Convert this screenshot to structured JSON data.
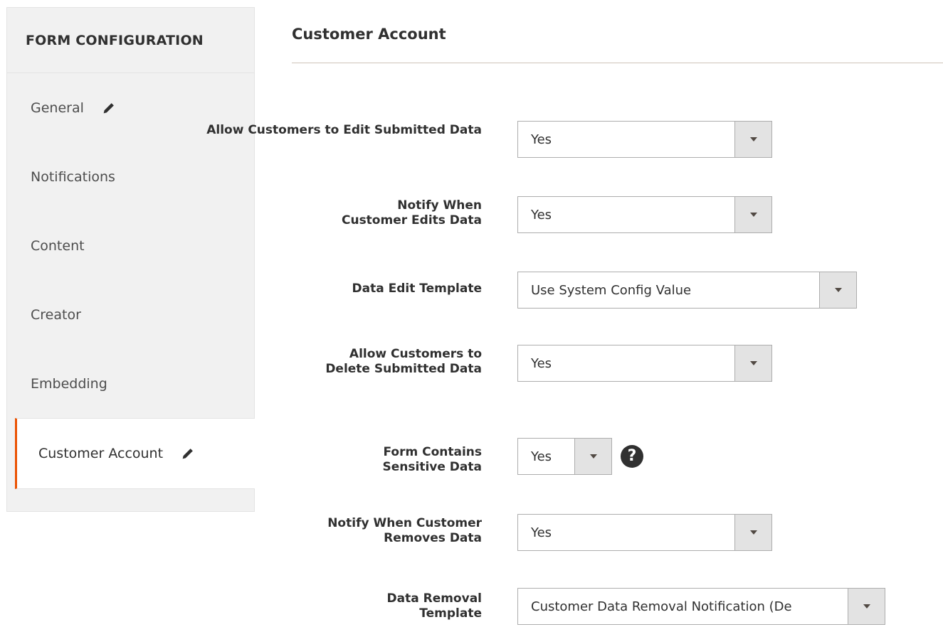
{
  "sidebar": {
    "header": "FORM CONFIGURATION",
    "items": [
      {
        "label": "General"
      },
      {
        "label": "Notifications"
      },
      {
        "label": "Content"
      },
      {
        "label": "Creator"
      },
      {
        "label": "Embedding"
      },
      {
        "label": "Customer Account"
      }
    ]
  },
  "main": {
    "title": "Customer Account",
    "fields": [
      {
        "label": "Allow Customers to Edit Submitted Data",
        "value": "Yes"
      },
      {
        "label": "Notify When Customer Edits Data",
        "value": "Yes"
      },
      {
        "label": "Data Edit Template",
        "value": "Use System Config Value"
      },
      {
        "label": "Allow Customers to Delete Submitted Data",
        "value": "Yes"
      },
      {
        "label": "Form Contains Sensitive Data",
        "value": "Yes"
      },
      {
        "label": "Notify When Customer Removes Data",
        "value": "Yes"
      },
      {
        "label": "Data Removal Template",
        "value": "Customer Data Removal Notification (De"
      }
    ],
    "help_icon": "?"
  },
  "colors": {
    "accent": "#eb5202",
    "sidebar_bg": "#f1f1f1",
    "text": "#303030"
  },
  "icons": {
    "edit": "pencil-icon",
    "dropdown": "triangle-down-icon",
    "help": "question-circle-icon"
  }
}
